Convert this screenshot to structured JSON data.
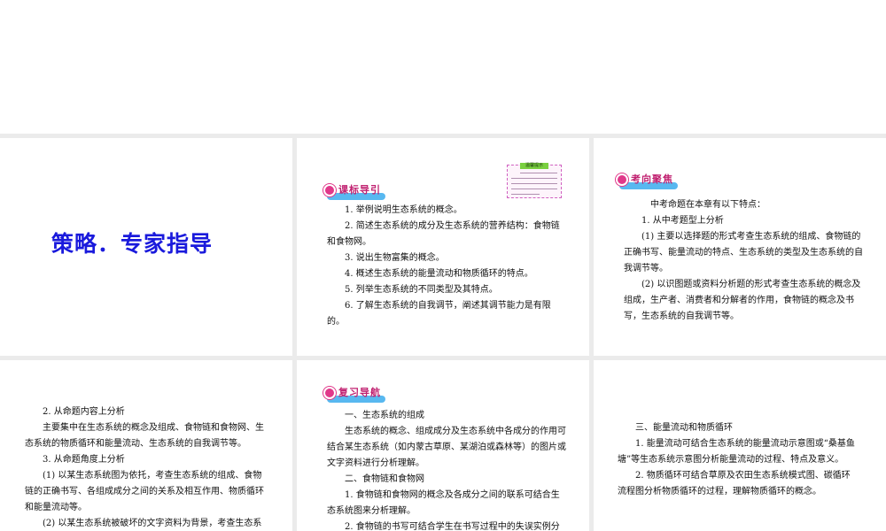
{
  "slide1": {
    "title": "策略．专家指导"
  },
  "slide2": {
    "badge": "课标导引",
    "note_title": "温馨提示",
    "lines": [
      "1. 举例说明生态系统的概念。",
      "2. 简述生态系统的成分及生态系统的营养结构：食物链和食物网。",
      "3. 说出生物富集的概念。",
      "4. 概述生态系统的能量流动和物质循环的特点。",
      "5. 列举生态系统的不同类型及其特点。",
      "6. 了解生态系统的自我调节，阐述其调节能力是有限的。"
    ]
  },
  "slide3": {
    "badge": "考向聚焦",
    "lines": [
      "中考命题在本章有以下特点：",
      "1. 从中考题型上分析",
      "(1) 主要以选择题的形式考查生态系统的组成、食物链的正确书写、能量流动的特点、生态系统的类型及生态系统的自我调节等。",
      "(2) 以识图题或资料分析题的形式考查生态系统的概念及组成，生产者、消费者和分解者的作用，食物链的概念及书写，生态系统的自我调节等。"
    ]
  },
  "slide4": {
    "lines": [
      "2. 从命题内容上分析",
      "主要集中在生态系统的概念及组成、食物链和食物网、生态系统的物质循环和能量流动、生态系统的自我调节等。",
      "3. 从命题角度上分析",
      "(1) 以某生态系统图为依托，考查生态系统的组成、食物链的正确书写、各组成成分之间的关系及相互作用、物质循环和能量流动等。",
      "(2) 以某生态系统被破坏的文字资料为背景，考查生态系"
    ]
  },
  "slide5": {
    "badge": "复习导航",
    "lines": [
      "一、生态系统的组成",
      "生态系统的概念、组成成分及生态系统中各成分的作用可结合某生态系统（如内蒙古草原、某湖泊或森林等）的图片或文字资料进行分析理解。",
      "二、食物链和食物网",
      "1. 食物链和食物网的概念及各成分之间的联系可结合生态系统图来分析理解。",
      "2. 食物链的书写可结合学生在书写过程中的失误实例分"
    ]
  },
  "slide6": {
    "lines": [
      "三、能量流动和物质循环",
      "1. 能量流动可结合生态系统的能量流动示意图或“桑基鱼塘”等生态系统示意图分析能量流动的过程、特点及意义。",
      "2. 物质循环可结合草原及农田生态系统模式图、碳循环流程图分析物质循环的过程，理解物质循环的概念。"
    ]
  }
}
